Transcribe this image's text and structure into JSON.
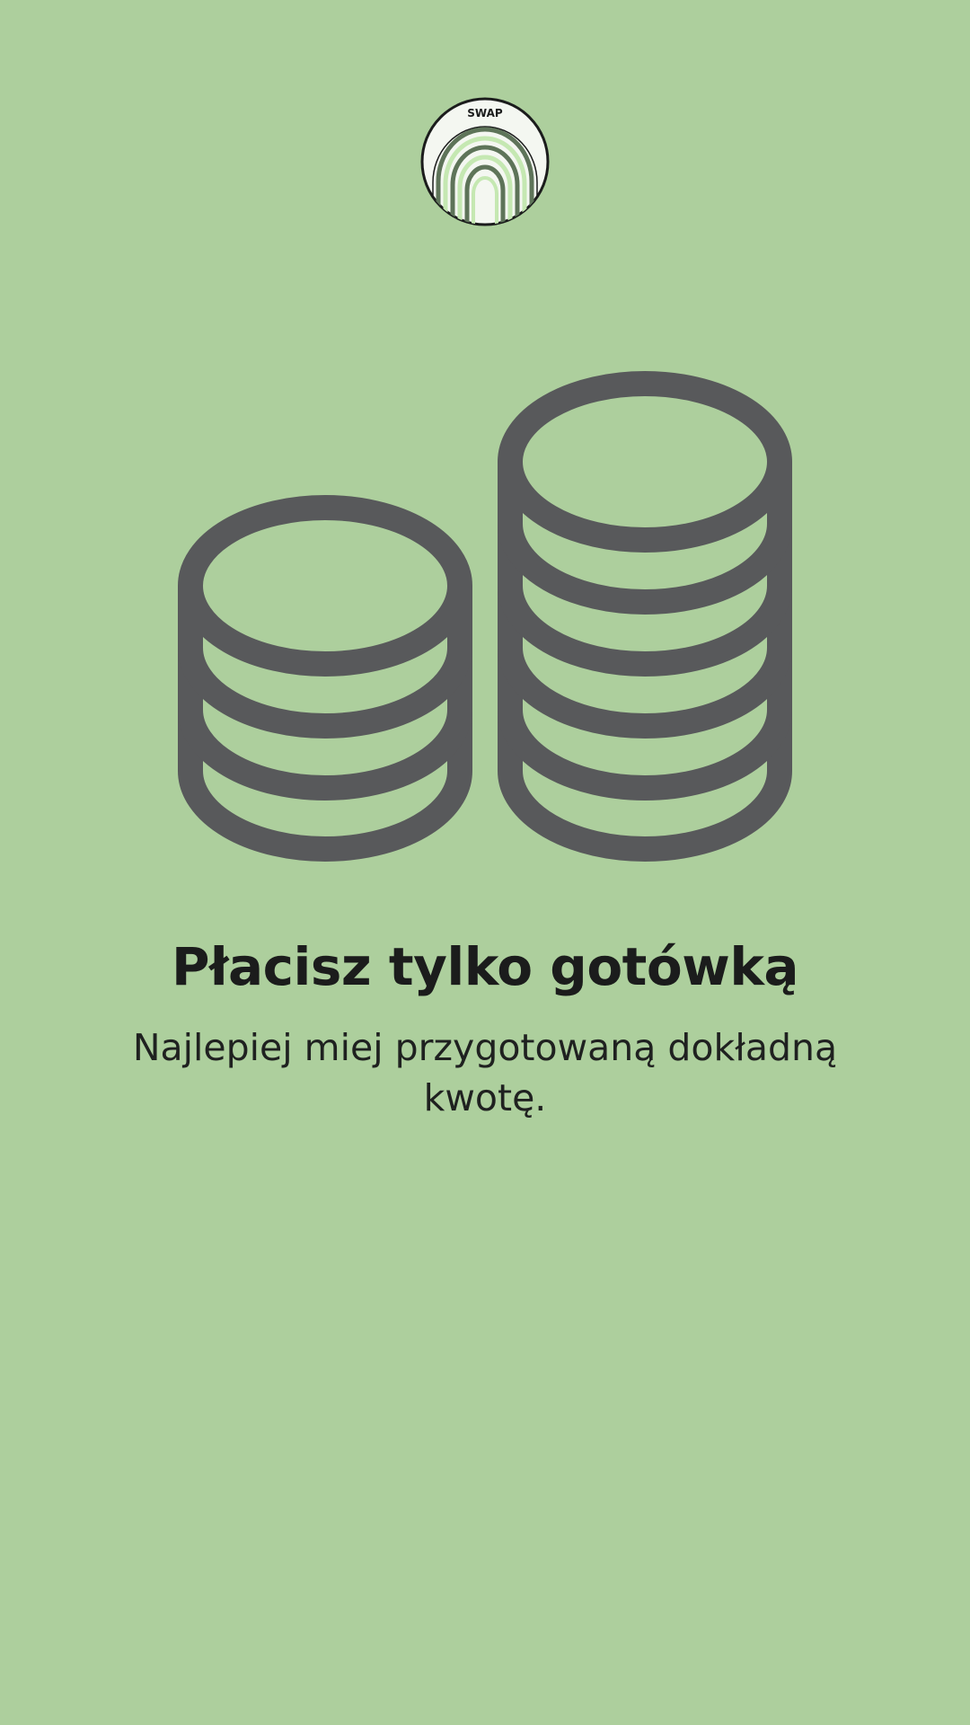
{
  "logo": {
    "text": "SWAP",
    "icon": "rainbow-arch-logo"
  },
  "illustration": {
    "icon": "coin-stacks-icon",
    "left_stack_coins": 4,
    "right_stack_coins": 6
  },
  "title": "Płacisz tylko gotówką",
  "subtitle": "Najlepiej miej przygotowaną dokładną kwotę.",
  "colors": {
    "background": "#adcf9d",
    "icon_stroke": "#58595b",
    "text": "#1b1c1c",
    "logo_dark": "#5e7459",
    "logo_light": "#c5e8b2"
  }
}
